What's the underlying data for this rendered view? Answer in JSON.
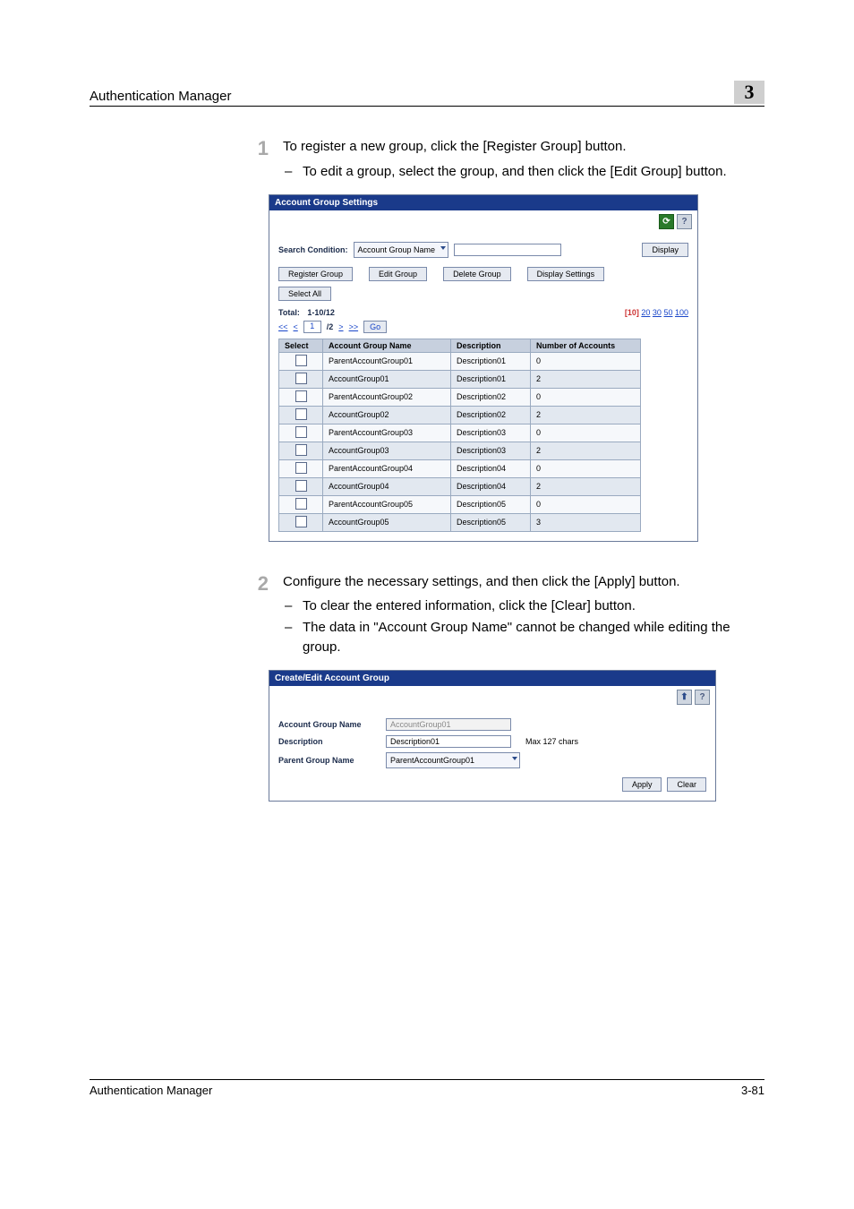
{
  "header": {
    "title": "Authentication Manager",
    "chapter": "3"
  },
  "steps": {
    "s1": {
      "num": "1",
      "text": "To register a new group, click the [Register Group] button.",
      "sub1": "To edit a group, select the group, and then click the [Edit Group] button."
    },
    "s2": {
      "num": "2",
      "text": "Configure the necessary settings, and then click the [Apply] button.",
      "sub1": "To clear the entered information, click the [Clear] button.",
      "sub2": "The data in \"Account Group Name\" cannot be changed while editing the group."
    }
  },
  "shot1": {
    "title": "Account Group Settings",
    "search_label": "Search Condition:",
    "search_select": "Account Group Name",
    "display_btn": "Display",
    "btns": {
      "register": "Register Group",
      "edit": "Edit Group",
      "delete": "Delete Group",
      "dispset": "Display Settings"
    },
    "select_all": "Select All",
    "total_label": "Total:",
    "total_value": "1-10/12",
    "page_sizes": {
      "cur": "[10]",
      "p20": "20",
      "p30": "30",
      "p50": "50",
      "p100": "100"
    },
    "pager": {
      "first": "<<",
      "prev": "<",
      "cur": "1",
      "p2": "/2",
      "next": ">",
      "last": ">>",
      "go_val": "1",
      "go": "Go"
    },
    "cols": {
      "select": "Select",
      "name": "Account Group Name",
      "desc": "Description",
      "num": "Number of Accounts"
    },
    "rows": [
      {
        "name": "ParentAccountGroup01",
        "desc": "Description01",
        "num": "0"
      },
      {
        "name": "AccountGroup01",
        "desc": "Description01",
        "num": "2"
      },
      {
        "name": "ParentAccountGroup02",
        "desc": "Description02",
        "num": "0"
      },
      {
        "name": "AccountGroup02",
        "desc": "Description02",
        "num": "2"
      },
      {
        "name": "ParentAccountGroup03",
        "desc": "Description03",
        "num": "0"
      },
      {
        "name": "AccountGroup03",
        "desc": "Description03",
        "num": "2"
      },
      {
        "name": "ParentAccountGroup04",
        "desc": "Description04",
        "num": "0"
      },
      {
        "name": "AccountGroup04",
        "desc": "Description04",
        "num": "2"
      },
      {
        "name": "ParentAccountGroup05",
        "desc": "Description05",
        "num": "0"
      },
      {
        "name": "AccountGroup05",
        "desc": "Description05",
        "num": "3"
      }
    ]
  },
  "shot2": {
    "title": "Create/Edit Account Group",
    "fields": {
      "name_lbl": "Account Group Name",
      "name_val": "AccountGroup01",
      "desc_lbl": "Description",
      "desc_val": "Description01",
      "desc_hint": "Max 127 chars",
      "parent_lbl": "Parent Group Name",
      "parent_val": "ParentAccountGroup01"
    },
    "apply": "Apply",
    "clear": "Clear"
  },
  "footer": {
    "left": "Authentication Manager",
    "right": "3-81"
  }
}
